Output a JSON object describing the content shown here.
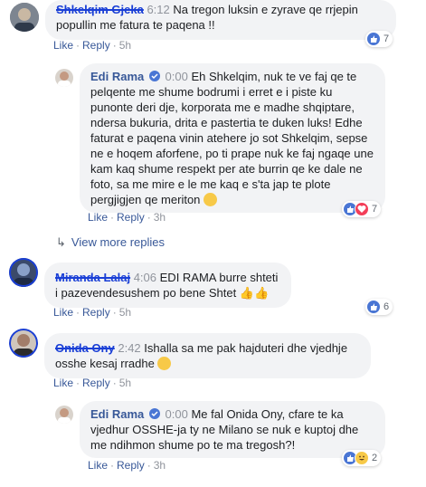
{
  "comments": [
    {
      "author": "Shkelqim Gjeka",
      "time": "6:12",
      "text": "Na tregon luksin e zyrave qe rrjepin popullin me fatura te paqena !!",
      "like": "Like",
      "reply": "Reply",
      "age": "5h",
      "reactions": {
        "count": "7",
        "types": [
          "like"
        ]
      }
    },
    {
      "author": "Edi Rama",
      "verified": true,
      "time": "0:00",
      "text": "Eh Shkelqim, nuk te ve faj qe te pelqente me shume bodrumi i erret e i piste ku punonte deri dje, korporata me e madhe shqiptare, ndersa bukuria, drita e pastertia te duken luks! Edhe faturat e paqena vinin atehere jo sot Shkelqim, sepse ne e hoqem aforfene, po ti prape nuk ke faj ngaqe une kam kaq shume respekt per ate burrin qe ke dale ne foto, sa me mire e le me kaq e s'ta jap te plote pergjigjen qe meriton",
      "emoji": "smile-emoji",
      "like": "Like",
      "reply": "Reply",
      "age": "3h",
      "reactions": {
        "count": "7",
        "types": [
          "like",
          "love"
        ]
      }
    },
    {
      "author": "Miranda Lalaj",
      "time": "4:06",
      "text": "EDI RAMA burre shteti i pazevendesushem po bene Shtet",
      "emoji": "thumbs-up-emoji",
      "like": "Like",
      "reply": "Reply",
      "age": "5h",
      "reactions": {
        "count": "6",
        "types": [
          "like"
        ]
      }
    },
    {
      "author": "Onida Ony",
      "time": "2:42",
      "text": "Ishalla sa me pak hajduteri dhe vjedhje osshe kesaj rradhe",
      "emoji": "praying-emoji",
      "like": "Like",
      "reply": "Reply",
      "age": "5h"
    },
    {
      "author": "Edi Rama",
      "verified": true,
      "time": "0:00",
      "text": "Me fal Onida Ony, cfare te ka vjedhur OSSHE-ja ty ne Milano se nuk e kuptoj dhe me ndihmon shume po te ma tregosh?!",
      "like": "Like",
      "reply": "Reply",
      "age": "3h",
      "reactions": {
        "count": "2",
        "types": [
          "like",
          "haha"
        ]
      }
    }
  ],
  "view_more": "View more replies",
  "colors": {
    "link": "#385898",
    "bubble": "#f2f3f5",
    "like_blue": "#4a76d4",
    "love_red": "#f33e58",
    "haha_yellow": "#f7c948"
  }
}
